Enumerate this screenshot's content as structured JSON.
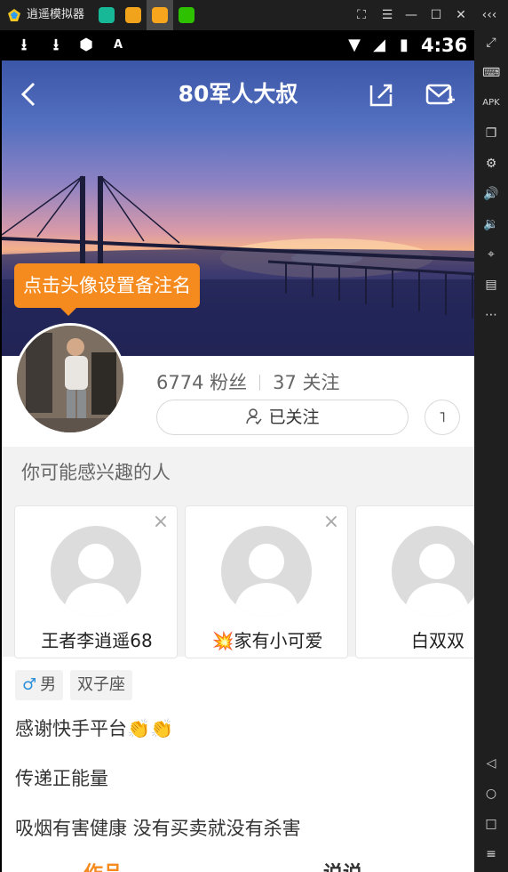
{
  "emulator": {
    "title": "逍遥模拟器",
    "apps": [
      "app-1",
      "app-2",
      "app-3",
      "wechat"
    ],
    "side_tools": [
      "fullscreen-icon",
      "keyboard-icon",
      "apk-icon",
      "multi-window-icon",
      "settings-icon",
      "volume-up-icon",
      "volume-down-icon",
      "location-icon",
      "folder-icon",
      "more-icon",
      "back-icon",
      "home-icon",
      "recents-icon",
      "menu-icon"
    ]
  },
  "status_bar": {
    "time": "4:36"
  },
  "profile": {
    "name": "80军人大叔",
    "tooltip": "点击头像设置备注名",
    "fans": "6774 粉丝",
    "following": "37 关注",
    "follow_state": "已关注",
    "more_label": "˥"
  },
  "recommend": {
    "title": "你可能感兴趣的人",
    "users": [
      {
        "name": "王者李逍遥68"
      },
      {
        "name": "💥家有小可爱"
      },
      {
        "name": "白双双"
      }
    ]
  },
  "tags": [
    {
      "icon": "♂",
      "label": "男"
    },
    {
      "label": "双子座"
    }
  ],
  "bio": {
    "line1": "感谢快手平台👏👏",
    "line2": "传递正能量",
    "line3": "吸烟有害健康  没有买卖就没有杀害"
  },
  "tabs": {
    "works": "作品",
    "second": "说说"
  },
  "colors": {
    "accent": "#f58b1f",
    "emulator_bg": "#1f1f1f"
  }
}
